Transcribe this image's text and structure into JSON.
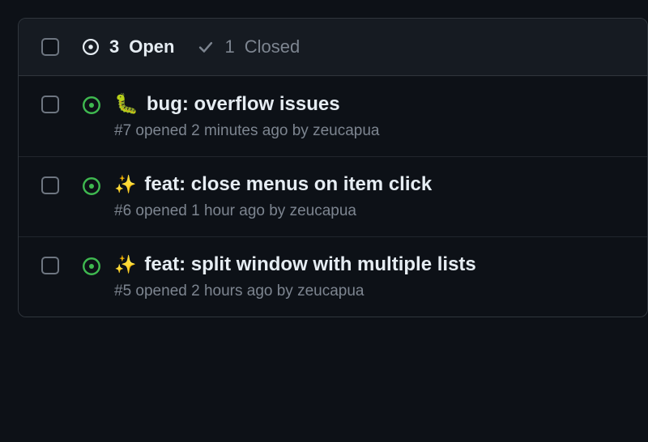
{
  "header": {
    "open_count": "3",
    "open_label": "Open",
    "closed_count": "1",
    "closed_label": "Closed"
  },
  "issues": [
    {
      "emoji": "🐛",
      "title": "bug: overflow issues",
      "number": "#7",
      "meta": "opened 2 minutes ago by zeucapua"
    },
    {
      "emoji": "✨",
      "title": "feat: close menus on item click",
      "number": "#6",
      "meta": "opened 1 hour ago by zeucapua"
    },
    {
      "emoji": "✨",
      "title": "feat: split window with multiple lists",
      "number": "#5",
      "meta": "opened 2 hours ago by zeucapua"
    }
  ],
  "colors": {
    "bg": "#0d1117",
    "header_bg": "#161b22",
    "border": "#30363d",
    "text_primary": "#e6edf3",
    "text_muted": "#7d8590",
    "green": "#3fb950"
  }
}
